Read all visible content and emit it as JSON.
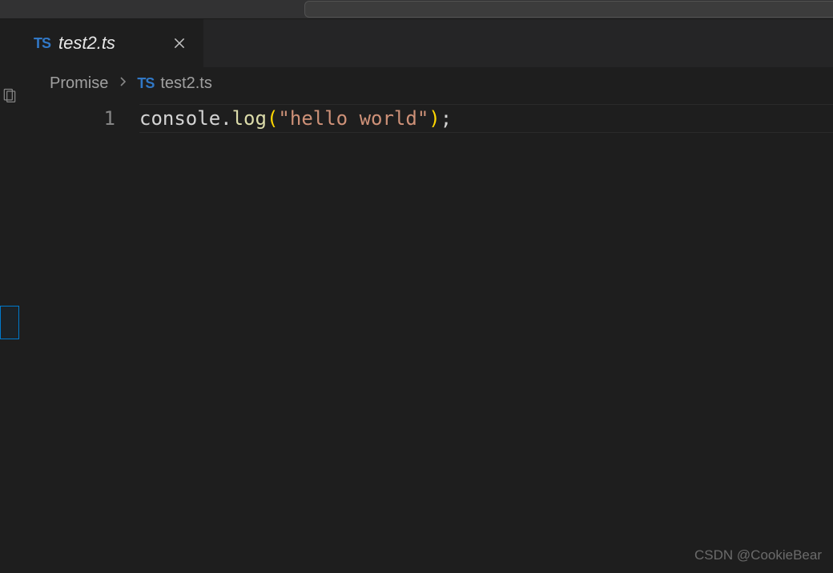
{
  "tab": {
    "icon_label": "TS",
    "filename": "test2.ts"
  },
  "breadcrumbs": {
    "folder": "Promise",
    "file_icon_label": "TS",
    "filename": "test2.ts"
  },
  "code": {
    "line_number": "1",
    "tokens": {
      "obj": "console",
      "dot": ".",
      "method": "log",
      "lparen": "(",
      "string": "\"hello world\"",
      "rparen": ")",
      "semi": ";"
    }
  },
  "watermark": "CSDN @CookieBear"
}
